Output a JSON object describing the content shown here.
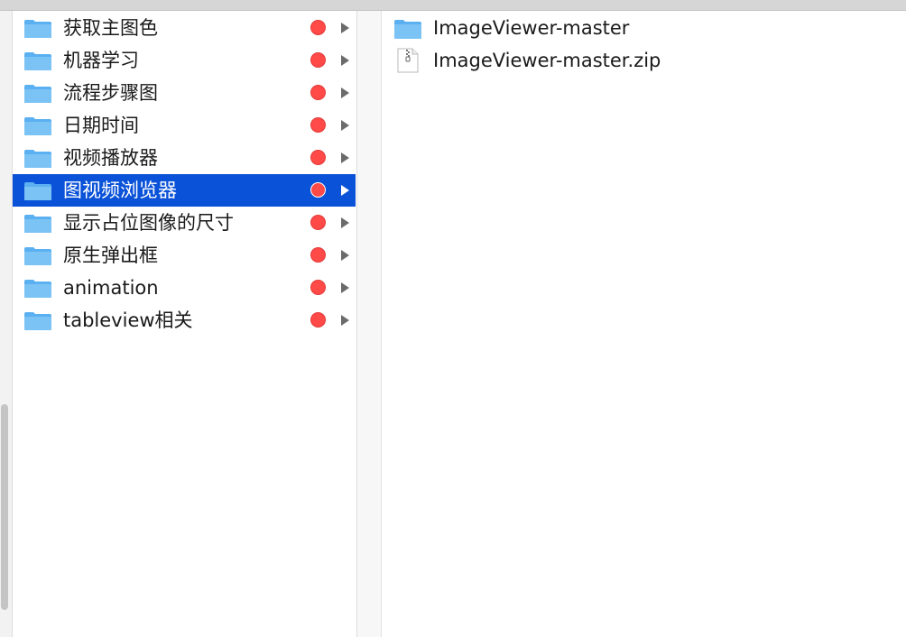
{
  "sidebar": {
    "items": [
      {
        "label": "获取主图色",
        "tag": "red"
      },
      {
        "label": "机器学习",
        "tag": "red"
      },
      {
        "label": "流程步骤图",
        "tag": "red"
      },
      {
        "label": "日期时间",
        "tag": "red"
      },
      {
        "label": "视频播放器",
        "tag": "red"
      },
      {
        "label": "图视频浏览器",
        "tag": "red",
        "selected": true
      },
      {
        "label": "显示占位图像的尺寸",
        "tag": "red"
      },
      {
        "label": "原生弹出框",
        "tag": "red"
      },
      {
        "label": "animation",
        "tag": "red"
      },
      {
        "label": "tableview相关",
        "tag": "red"
      }
    ]
  },
  "contents": {
    "items": [
      {
        "label": "ImageViewer-master",
        "icon": "folder-icon"
      },
      {
        "label": "ImageViewer-master.zip",
        "icon": "zip-file-icon"
      }
    ]
  },
  "colors": {
    "selection": "#0a52d8",
    "tag_red": "#ff4a48",
    "folder_blue": "#5ab0f0"
  }
}
